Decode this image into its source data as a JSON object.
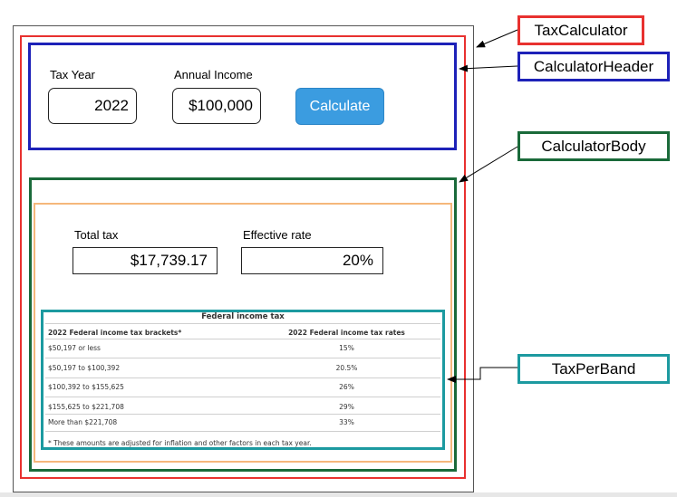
{
  "colors": {
    "tax_calculator": "#e8312f",
    "calculator_header": "#1d21b8",
    "calculator_body": "#1a6a3a",
    "inner_panel": "#f5b77b",
    "tax_per_band": "#1c9aa0",
    "calculate_button": "#3b9ce0"
  },
  "header": {
    "tax_year_label": "Tax Year",
    "tax_year_value": "2022",
    "annual_income_label": "Annual Income",
    "annual_income_value": "$100,000",
    "calculate_label": "Calculate"
  },
  "body": {
    "total_tax_label": "Total tax",
    "total_tax_value": "$17,739.17",
    "effective_rate_label": "Effective rate",
    "effective_rate_value": "20%"
  },
  "table": {
    "title": "Federal income tax",
    "col1_header": "2022 Federal income tax brackets*",
    "col2_header": "2022 Federal income tax rates",
    "rows": [
      {
        "bracket": "$50,197 or less",
        "rate": "15%"
      },
      {
        "bracket": "$50,197 to $100,392",
        "rate": "20.5%"
      },
      {
        "bracket": "$100,392 to $155,625",
        "rate": "26%"
      },
      {
        "bracket": "$155,625 to $221,708",
        "rate": "29%"
      },
      {
        "bracket": "More than $221,708",
        "rate": "33%"
      }
    ],
    "footnote": "* These amounts are adjusted for inflation and other factors in each tax year."
  },
  "callouts": {
    "tax_calculator": "TaxCalculator",
    "calculator_header": "CalculatorHeader",
    "calculator_body": "CalculatorBody",
    "tax_per_band": "TaxPerBand"
  }
}
